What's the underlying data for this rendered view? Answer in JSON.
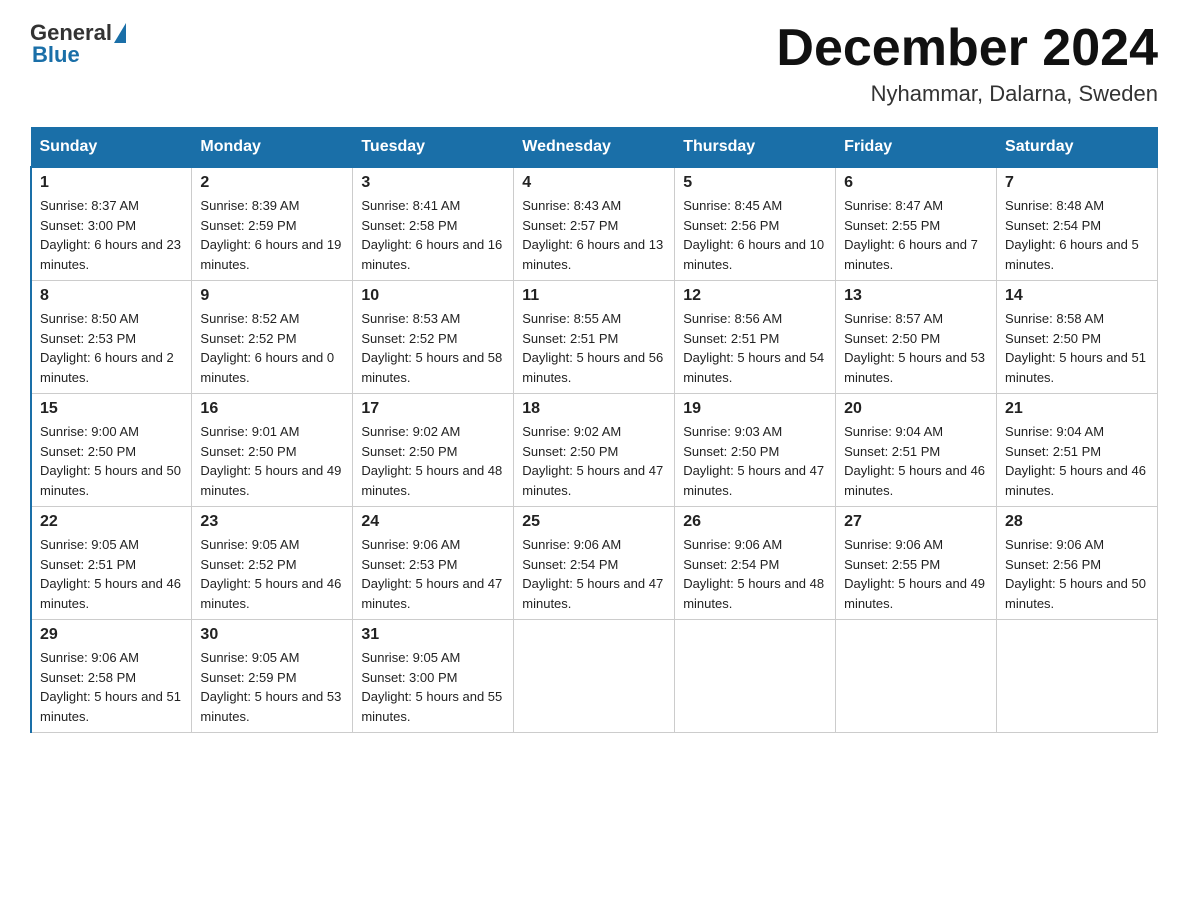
{
  "header": {
    "logo_general": "General",
    "logo_blue": "Blue",
    "title": "December 2024",
    "subtitle": "Nyhammar, Dalarna, Sweden"
  },
  "days_of_week": [
    "Sunday",
    "Monday",
    "Tuesday",
    "Wednesday",
    "Thursday",
    "Friday",
    "Saturday"
  ],
  "weeks": [
    [
      {
        "day": "1",
        "sunrise": "Sunrise: 8:37 AM",
        "sunset": "Sunset: 3:00 PM",
        "daylight": "Daylight: 6 hours and 23 minutes."
      },
      {
        "day": "2",
        "sunrise": "Sunrise: 8:39 AM",
        "sunset": "Sunset: 2:59 PM",
        "daylight": "Daylight: 6 hours and 19 minutes."
      },
      {
        "day": "3",
        "sunrise": "Sunrise: 8:41 AM",
        "sunset": "Sunset: 2:58 PM",
        "daylight": "Daylight: 6 hours and 16 minutes."
      },
      {
        "day": "4",
        "sunrise": "Sunrise: 8:43 AM",
        "sunset": "Sunset: 2:57 PM",
        "daylight": "Daylight: 6 hours and 13 minutes."
      },
      {
        "day": "5",
        "sunrise": "Sunrise: 8:45 AM",
        "sunset": "Sunset: 2:56 PM",
        "daylight": "Daylight: 6 hours and 10 minutes."
      },
      {
        "day": "6",
        "sunrise": "Sunrise: 8:47 AM",
        "sunset": "Sunset: 2:55 PM",
        "daylight": "Daylight: 6 hours and 7 minutes."
      },
      {
        "day": "7",
        "sunrise": "Sunrise: 8:48 AM",
        "sunset": "Sunset: 2:54 PM",
        "daylight": "Daylight: 6 hours and 5 minutes."
      }
    ],
    [
      {
        "day": "8",
        "sunrise": "Sunrise: 8:50 AM",
        "sunset": "Sunset: 2:53 PM",
        "daylight": "Daylight: 6 hours and 2 minutes."
      },
      {
        "day": "9",
        "sunrise": "Sunrise: 8:52 AM",
        "sunset": "Sunset: 2:52 PM",
        "daylight": "Daylight: 6 hours and 0 minutes."
      },
      {
        "day": "10",
        "sunrise": "Sunrise: 8:53 AM",
        "sunset": "Sunset: 2:52 PM",
        "daylight": "Daylight: 5 hours and 58 minutes."
      },
      {
        "day": "11",
        "sunrise": "Sunrise: 8:55 AM",
        "sunset": "Sunset: 2:51 PM",
        "daylight": "Daylight: 5 hours and 56 minutes."
      },
      {
        "day": "12",
        "sunrise": "Sunrise: 8:56 AM",
        "sunset": "Sunset: 2:51 PM",
        "daylight": "Daylight: 5 hours and 54 minutes."
      },
      {
        "day": "13",
        "sunrise": "Sunrise: 8:57 AM",
        "sunset": "Sunset: 2:50 PM",
        "daylight": "Daylight: 5 hours and 53 minutes."
      },
      {
        "day": "14",
        "sunrise": "Sunrise: 8:58 AM",
        "sunset": "Sunset: 2:50 PM",
        "daylight": "Daylight: 5 hours and 51 minutes."
      }
    ],
    [
      {
        "day": "15",
        "sunrise": "Sunrise: 9:00 AM",
        "sunset": "Sunset: 2:50 PM",
        "daylight": "Daylight: 5 hours and 50 minutes."
      },
      {
        "day": "16",
        "sunrise": "Sunrise: 9:01 AM",
        "sunset": "Sunset: 2:50 PM",
        "daylight": "Daylight: 5 hours and 49 minutes."
      },
      {
        "day": "17",
        "sunrise": "Sunrise: 9:02 AM",
        "sunset": "Sunset: 2:50 PM",
        "daylight": "Daylight: 5 hours and 48 minutes."
      },
      {
        "day": "18",
        "sunrise": "Sunrise: 9:02 AM",
        "sunset": "Sunset: 2:50 PM",
        "daylight": "Daylight: 5 hours and 47 minutes."
      },
      {
        "day": "19",
        "sunrise": "Sunrise: 9:03 AM",
        "sunset": "Sunset: 2:50 PM",
        "daylight": "Daylight: 5 hours and 47 minutes."
      },
      {
        "day": "20",
        "sunrise": "Sunrise: 9:04 AM",
        "sunset": "Sunset: 2:51 PM",
        "daylight": "Daylight: 5 hours and 46 minutes."
      },
      {
        "day": "21",
        "sunrise": "Sunrise: 9:04 AM",
        "sunset": "Sunset: 2:51 PM",
        "daylight": "Daylight: 5 hours and 46 minutes."
      }
    ],
    [
      {
        "day": "22",
        "sunrise": "Sunrise: 9:05 AM",
        "sunset": "Sunset: 2:51 PM",
        "daylight": "Daylight: 5 hours and 46 minutes."
      },
      {
        "day": "23",
        "sunrise": "Sunrise: 9:05 AM",
        "sunset": "Sunset: 2:52 PM",
        "daylight": "Daylight: 5 hours and 46 minutes."
      },
      {
        "day": "24",
        "sunrise": "Sunrise: 9:06 AM",
        "sunset": "Sunset: 2:53 PM",
        "daylight": "Daylight: 5 hours and 47 minutes."
      },
      {
        "day": "25",
        "sunrise": "Sunrise: 9:06 AM",
        "sunset": "Sunset: 2:54 PM",
        "daylight": "Daylight: 5 hours and 47 minutes."
      },
      {
        "day": "26",
        "sunrise": "Sunrise: 9:06 AM",
        "sunset": "Sunset: 2:54 PM",
        "daylight": "Daylight: 5 hours and 48 minutes."
      },
      {
        "day": "27",
        "sunrise": "Sunrise: 9:06 AM",
        "sunset": "Sunset: 2:55 PM",
        "daylight": "Daylight: 5 hours and 49 minutes."
      },
      {
        "day": "28",
        "sunrise": "Sunrise: 9:06 AM",
        "sunset": "Sunset: 2:56 PM",
        "daylight": "Daylight: 5 hours and 50 minutes."
      }
    ],
    [
      {
        "day": "29",
        "sunrise": "Sunrise: 9:06 AM",
        "sunset": "Sunset: 2:58 PM",
        "daylight": "Daylight: 5 hours and 51 minutes."
      },
      {
        "day": "30",
        "sunrise": "Sunrise: 9:05 AM",
        "sunset": "Sunset: 2:59 PM",
        "daylight": "Daylight: 5 hours and 53 minutes."
      },
      {
        "day": "31",
        "sunrise": "Sunrise: 9:05 AM",
        "sunset": "Sunset: 3:00 PM",
        "daylight": "Daylight: 5 hours and 55 minutes."
      },
      null,
      null,
      null,
      null
    ]
  ]
}
